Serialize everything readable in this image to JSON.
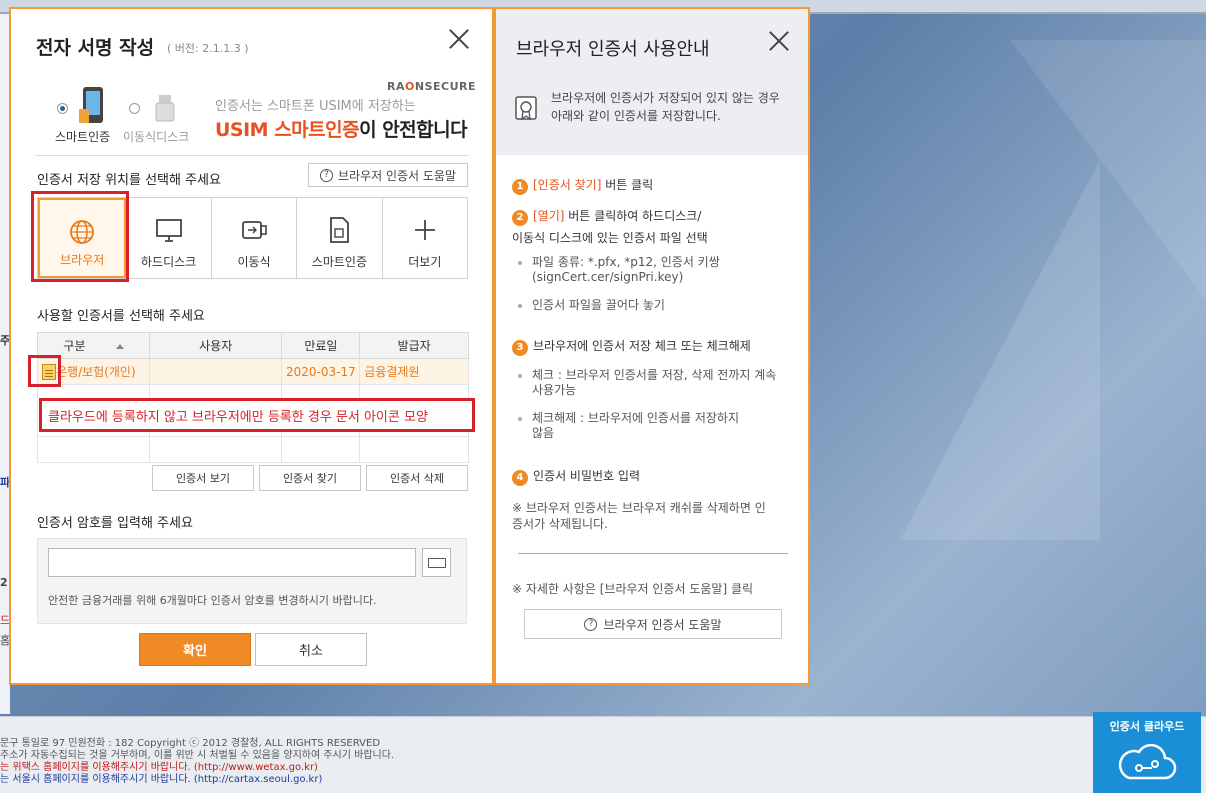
{
  "dialog": {
    "title": "전자 서명 작성",
    "version": "( 버전: 2.1.1.3 )",
    "media": {
      "smart": "스마트인증",
      "removable": "이동식디스크"
    },
    "ad": {
      "brand_a": "RA",
      "brand_b": "O",
      "brand_c": "N",
      "brand_d": "SECURE",
      "line1": "인증서는 스마트폰 USIM에 저장하는",
      "line2_hl": "USIM 스마트인증",
      "line2_rest": "이 안전합니다"
    },
    "storage_title": "인증서 저장 위치를 선택해 주세요",
    "help_label": "브라우저 인증서 도움말",
    "stores": [
      "브라우저",
      "하드디스크",
      "이동식",
      "스마트인증",
      "더보기"
    ],
    "cert_title": "사용할 인증서를 선택해 주세요",
    "table": {
      "headers": [
        "구분",
        "사용자",
        "만료일",
        "발급자"
      ],
      "rows": [
        {
          "type": "은행/보험(개인)",
          "user": "",
          "expiry": "2020-03-17",
          "issuer": "금융결제원"
        }
      ]
    },
    "annotation": "클라우드에 등록하지 않고 브라우저에만 등록한 경우 문서 아이콘 모양",
    "buttons": {
      "view": "인증서 보기",
      "find": "인증서 찾기",
      "delete": "인증서 삭제"
    },
    "password_title": "인증서 암호를 입력해 주세요",
    "password_value": "",
    "password_note": "안전한 금융거래를 위해 6개월마다 인증서 암호를 변경하시기 바랍니다.",
    "ok": "확인",
    "cancel": "취소"
  },
  "guide": {
    "title": "브라우저 인증서 사용안내",
    "intro1": "브라우저에 인증서가 저장되어 있지 않는 경우",
    "intro2": "아래와 같이 인증서를 저장합니다.",
    "step1_em": "[인증서 찾기]",
    "step1_rest": " 버튼 클릭",
    "step2_em": "[열기]",
    "step2_rest": " 버튼 클릭하여 하드디스크/",
    "step2_line2": "이동식 디스크에 있는 인증서 파일 선택",
    "step2_b1a": "파일 종류: *.pfx, *p12, 인증서 키쌍",
    "step2_b1b": "(signCert.cer/signPri.key)",
    "step2_b2": "인증서 파일을 끌어다 놓기",
    "step3": "브라우저에 인증서 저장 체크 또는 체크해제",
    "step3_b1a": "체크 : 브라우저 인증서를 저장, 삭제 전까지 계속",
    "step3_b1b": "사용가능",
    "step3_b2a": "체크해제 : 브라우저에 인증서를 저장하지",
    "step3_b2b": "않음",
    "step4": "인증서 비밀번호 입력",
    "note1a": "※ 브라우저 인증서는 브라우저 캐쉬를 삭제하면 인",
    "note1b": "증서가 삭제됩니다.",
    "note2": "※ 자세한 사항은 [브라우저 인증서 도움말] 클릭",
    "help_btn": "브라우저 인증서 도움말",
    "nums": [
      "1",
      "2",
      "3",
      "4"
    ]
  },
  "background": {
    "footer1": "문구 통일로 97 민원전화 : 182      Copyright ⓒ 2012 경찰청, ALL RIGHTS RESERVED",
    "footer2": "주소가 자동수집되는 것을 거부하며, 이를 위반 시 처벌될 수 있음을 양지하여 주시기 바랍니다.",
    "footer3": "는 위택스 홈페이지를 이용해주시기 바랍니다. (http://www.wetax.go.kr)",
    "footer4": "는 서울시 홈페이지를 이용해주시기 바랍니다. (http://cartax.seoul.go.kr)",
    "cloud_label": "인증서 클라우드",
    "side": [
      "주",
      "파",
      "2",
      "드",
      "홈"
    ]
  },
  "colors": {
    "accent": "#f39a37",
    "button": "#f08a24",
    "annotation": "#d8202a",
    "cloud": "#1a8fd8"
  }
}
